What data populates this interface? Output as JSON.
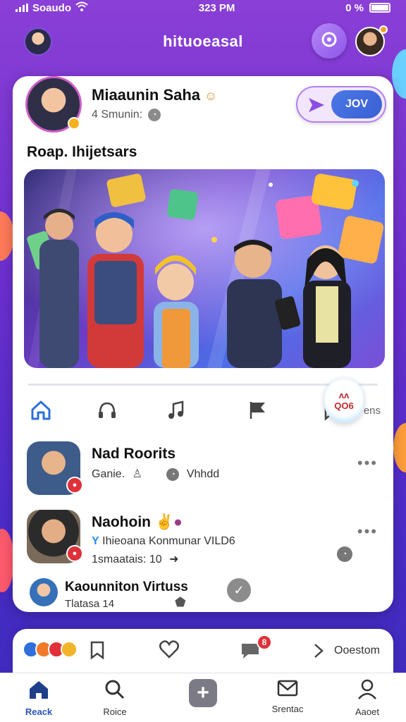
{
  "status_bar": {
    "carrier": "Soaudo",
    "time": "323 PM",
    "battery": "0 %"
  },
  "app_bar": {
    "title": "hituoeasal"
  },
  "user": {
    "name": "Miaaunin Saha",
    "meta": "4 Smunin:"
  },
  "join_button": {
    "label": "JOV"
  },
  "section_title": "Roap. Ihijetsars",
  "icon_row": {
    "trailing_label": "ens"
  },
  "sticker": {
    "line1": "ᴧᴧ",
    "line2": "QO6"
  },
  "posts": [
    {
      "title": "Nad Roorits",
      "line1": "Ganie.",
      "line1b": "Vhhdd"
    },
    {
      "title": "Naohoin",
      "line1": "Ihieoana Konmunar VILD6",
      "line2": "1smaatais: 10"
    },
    {
      "title": "Kaounniton Virtuss",
      "line1": "Tlatasa 14"
    }
  ],
  "bottom_card": {
    "badge": "8",
    "label": "Ooestom"
  },
  "tabs": [
    {
      "label": "Reack",
      "icon": "home-icon"
    },
    {
      "label": "Roice",
      "icon": "search-icon"
    },
    {
      "label": "",
      "icon": "add-icon"
    },
    {
      "label": "Srentac",
      "icon": "mail-icon"
    },
    {
      "label": "Aaoet",
      "icon": "person-icon"
    }
  ],
  "colors": {
    "accent": "#3a5fd4",
    "brand_purple": "#8a3fd6",
    "badge_red": "#e0303a"
  }
}
